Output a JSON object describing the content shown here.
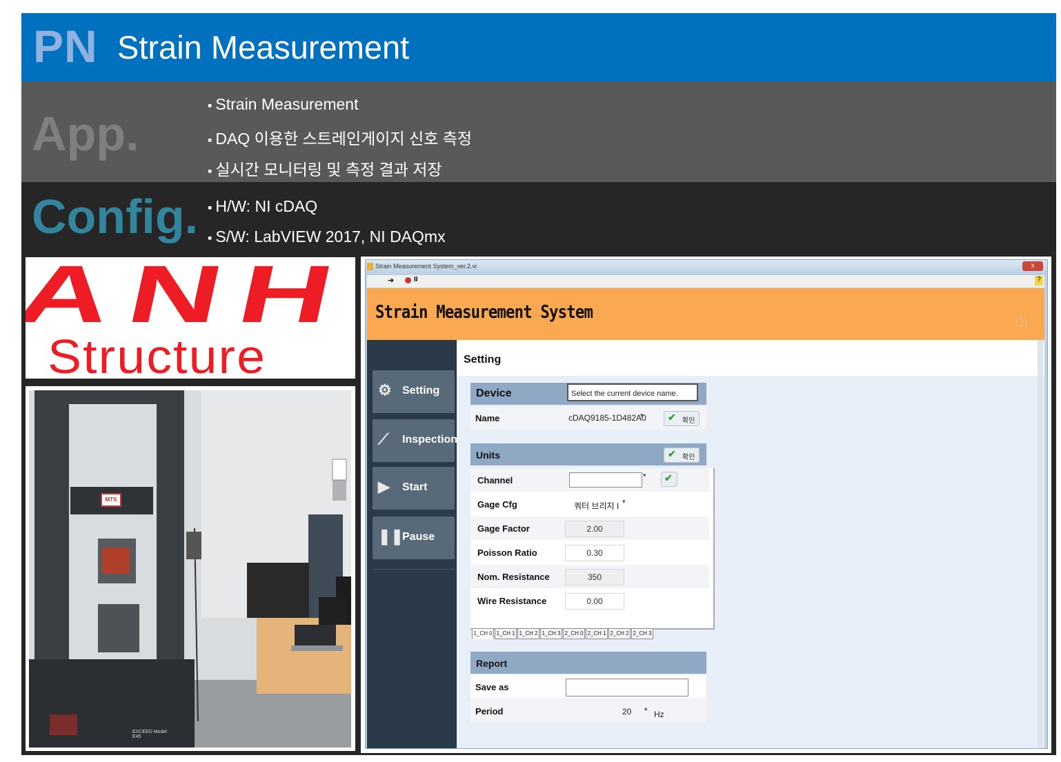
{
  "header": {
    "prefix": "PN",
    "title": "Strain Measurement"
  },
  "app": {
    "label": "App.",
    "bullets": [
      "Strain  Measurement",
      "DAQ 이용한 스트레인게이지 신호 측정",
      "실시간 모니터링 및 측정 결과 저장"
    ]
  },
  "config": {
    "label": "Config.",
    "bullets": [
      "H/W: NI cDAQ",
      "S/W: LabVIEW 2017, NI DAQmx"
    ]
  },
  "logo": {
    "word1": "ANH",
    "word2": "Structure",
    "red": "#ee1c25"
  },
  "photo": {
    "badge": "MTS",
    "model": "EXCEED Model E45"
  },
  "app_window": {
    "window_title": "Strain Measurement System_ver.2.vi",
    "close": "x",
    "help": "?",
    "banner_title": "Strain Measurement System",
    "nav": [
      {
        "label": "Setting",
        "icon": "gear-icon"
      },
      {
        "label": "Inspection",
        "icon": "chart-icon"
      },
      {
        "label": "Start",
        "icon": "play-icon"
      },
      {
        "label": "Pause",
        "icon": "pause-icon"
      }
    ],
    "section_title": "Setting",
    "device": {
      "title": "Device",
      "hint": "Select the current device name.",
      "name_label": "Name",
      "name_value": "cDAQ9185-1D482A0",
      "ok_label": "확인"
    },
    "units": {
      "title": "Units",
      "ok_label": "확인",
      "rows": [
        {
          "label": "Channel",
          "value": ""
        },
        {
          "label": "Gage Cfg",
          "value": "쿼터 브리지 I"
        },
        {
          "label": "Gage Factor",
          "value": "2.00"
        },
        {
          "label": "Poisson Ratio",
          "value": "0.30"
        },
        {
          "label": "Nom. Resistance",
          "value": "350"
        },
        {
          "label": "Wire Resistance",
          "value": "0.00"
        }
      ],
      "tabs": [
        "1_CH 0",
        "1_CH 1",
        "1_CH 2",
        "1_CH 3",
        "2_CH 0",
        "2_CH 1",
        "2_CH 2",
        "2_CH 3"
      ]
    },
    "report": {
      "title": "Report",
      "save_label": "Save as",
      "save_value": "",
      "period_label": "Period",
      "period_value": "20",
      "period_unit": "Hz"
    },
    "colors": {
      "banner": "#fba950",
      "nav_bg": "#2b3a48",
      "section_bar": "#8fa9c4"
    }
  }
}
